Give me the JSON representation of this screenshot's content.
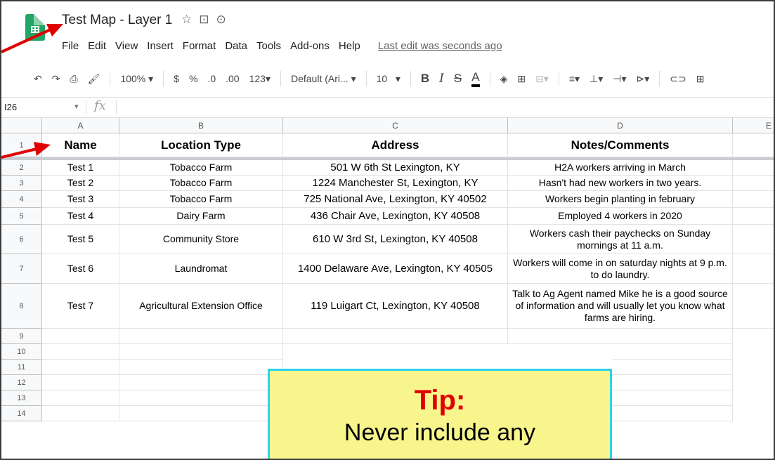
{
  "app": {
    "title": "Test Map - Layer 1",
    "title_icons": [
      "star-icon",
      "move-to-folder-icon",
      "cloud-status-icon"
    ],
    "menu": [
      "File",
      "Edit",
      "View",
      "Insert",
      "Format",
      "Data",
      "Tools",
      "Add-ons",
      "Help"
    ],
    "last_edit": "Last edit was seconds ago"
  },
  "toolbar": {
    "zoom": "100% ▾",
    "currency": "$",
    "percent": "%",
    "decrease_decimal": ".0",
    "increase_decimal": ".00",
    "more_formats": "123▾",
    "font": "Default (Ari... ▾",
    "font_size": "10",
    "font_size_caret": "▾",
    "bold": "B",
    "italic": "I",
    "strike": "S",
    "text_color": "A"
  },
  "formula_bar": {
    "cell_ref": "I26",
    "fx": "fx"
  },
  "sheet": {
    "columns": [
      "A",
      "B",
      "C",
      "D",
      "E"
    ],
    "header": [
      "Name",
      "Location Type",
      "Address",
      "Notes/Comments"
    ],
    "rows": [
      {
        "num": "2",
        "cells": [
          "Test 1",
          "Tobacco Farm",
          "501 W 6th St Lexington, KY",
          "H2A workers arriving in March"
        ]
      },
      {
        "num": "3",
        "cells": [
          "Test 2",
          "Tobacco Farm",
          "1224 Manchester St, Lexington, KY",
          "Hasn't had new workers in two years."
        ]
      },
      {
        "num": "4",
        "cells": [
          "Test 3",
          "Tobacco Farm",
          "725 National Ave, Lexington, KY 40502",
          "Workers begin planting in february"
        ]
      },
      {
        "num": "5",
        "cells": [
          "Test 4",
          "Dairy Farm",
          "436 Chair Ave, Lexington, KY 40508",
          "Employed 4 workers in 2020"
        ]
      },
      {
        "num": "6",
        "cells": [
          "Test 5",
          "Community Store",
          "610 W 3rd St, Lexington, KY 40508",
          "Workers cash their paychecks on Sunday mornings at 11 a.m."
        ]
      },
      {
        "num": "7",
        "cells": [
          "Test 6",
          "Laundromat",
          "1400 Delaware Ave, Lexington, KY 40505",
          "Workers will come in on saturday nights at 9 p.m. to do laundry."
        ]
      },
      {
        "num": "8",
        "cells": [
          "Test 7",
          "Agricultural Extension Office",
          "119 Luigart Ct, Lexington, KY 40508",
          "Talk to Ag Agent named Mike he is a good source of information and will usually let you know what farms are hiring."
        ]
      }
    ],
    "empty_rows": [
      "9",
      "10",
      "11",
      "12",
      "13",
      "14"
    ]
  },
  "tip": {
    "title": "Tip:",
    "text": "Never include any"
  },
  "colors": {
    "accent_green": "#23a566",
    "arrow_red": "#e00000",
    "tip_bg": "#f8f58c",
    "tip_border": "#2cd3e8"
  }
}
